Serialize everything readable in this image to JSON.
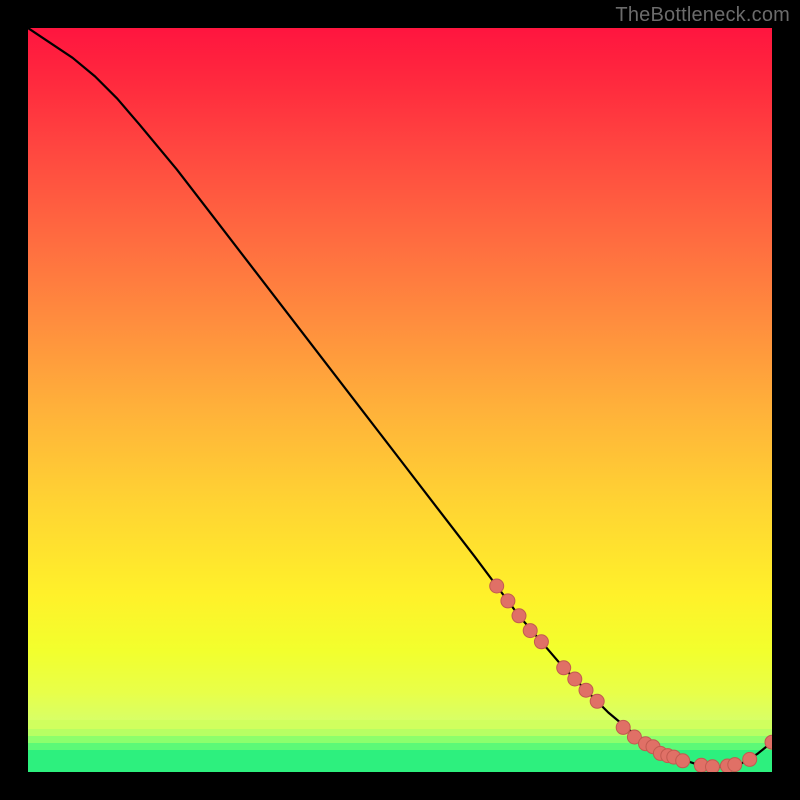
{
  "watermark": "TheBottleneck.com",
  "colors": {
    "bg": "#000000",
    "curve": "#000000",
    "marker_fill": "#e07066",
    "marker_stroke": "#c25a50",
    "band_green": "#2df07e",
    "band_light": "#e8ff49"
  },
  "chart_data": {
    "type": "line",
    "title": "",
    "xlabel": "",
    "ylabel": "",
    "xlim": [
      0,
      100
    ],
    "ylim": [
      0,
      100
    ],
    "grid": false,
    "legend": false,
    "series": [
      {
        "name": "bottleneck-curve",
        "x": [
          0,
          3,
          6,
          9,
          12,
          15,
          20,
          25,
          30,
          35,
          40,
          45,
          50,
          55,
          60,
          63,
          66,
          69,
          72,
          75,
          78,
          81,
          84,
          87,
          90,
          93,
          96,
          98,
          100
        ],
        "y": [
          100,
          98,
          96,
          93.5,
          90.5,
          87,
          81,
          74.5,
          68,
          61.5,
          55,
          48.5,
          42,
          35.5,
          29,
          25,
          21,
          17.5,
          14,
          11,
          8,
          5.5,
          3.5,
          2,
          1,
          0.7,
          1.2,
          2.4,
          4
        ]
      }
    ],
    "markers": {
      "name": "highlighted-points",
      "points": [
        {
          "x": 63,
          "y": 25
        },
        {
          "x": 64.5,
          "y": 23
        },
        {
          "x": 66,
          "y": 21
        },
        {
          "x": 67.5,
          "y": 19
        },
        {
          "x": 69,
          "y": 17.5
        },
        {
          "x": 72,
          "y": 14
        },
        {
          "x": 73.5,
          "y": 12.5
        },
        {
          "x": 75,
          "y": 11
        },
        {
          "x": 76.5,
          "y": 9.5
        },
        {
          "x": 80,
          "y": 6
        },
        {
          "x": 81.5,
          "y": 4.7
        },
        {
          "x": 83,
          "y": 3.8
        },
        {
          "x": 84,
          "y": 3.4
        },
        {
          "x": 85,
          "y": 2.5
        },
        {
          "x": 86,
          "y": 2.2
        },
        {
          "x": 86.8,
          "y": 2.0
        },
        {
          "x": 88,
          "y": 1.5
        },
        {
          "x": 90.5,
          "y": 0.9
        },
        {
          "x": 92,
          "y": 0.7
        },
        {
          "x": 94,
          "y": 0.8
        },
        {
          "x": 95,
          "y": 1.0
        },
        {
          "x": 97,
          "y": 1.7
        },
        {
          "x": 100,
          "y": 4
        }
      ]
    }
  }
}
